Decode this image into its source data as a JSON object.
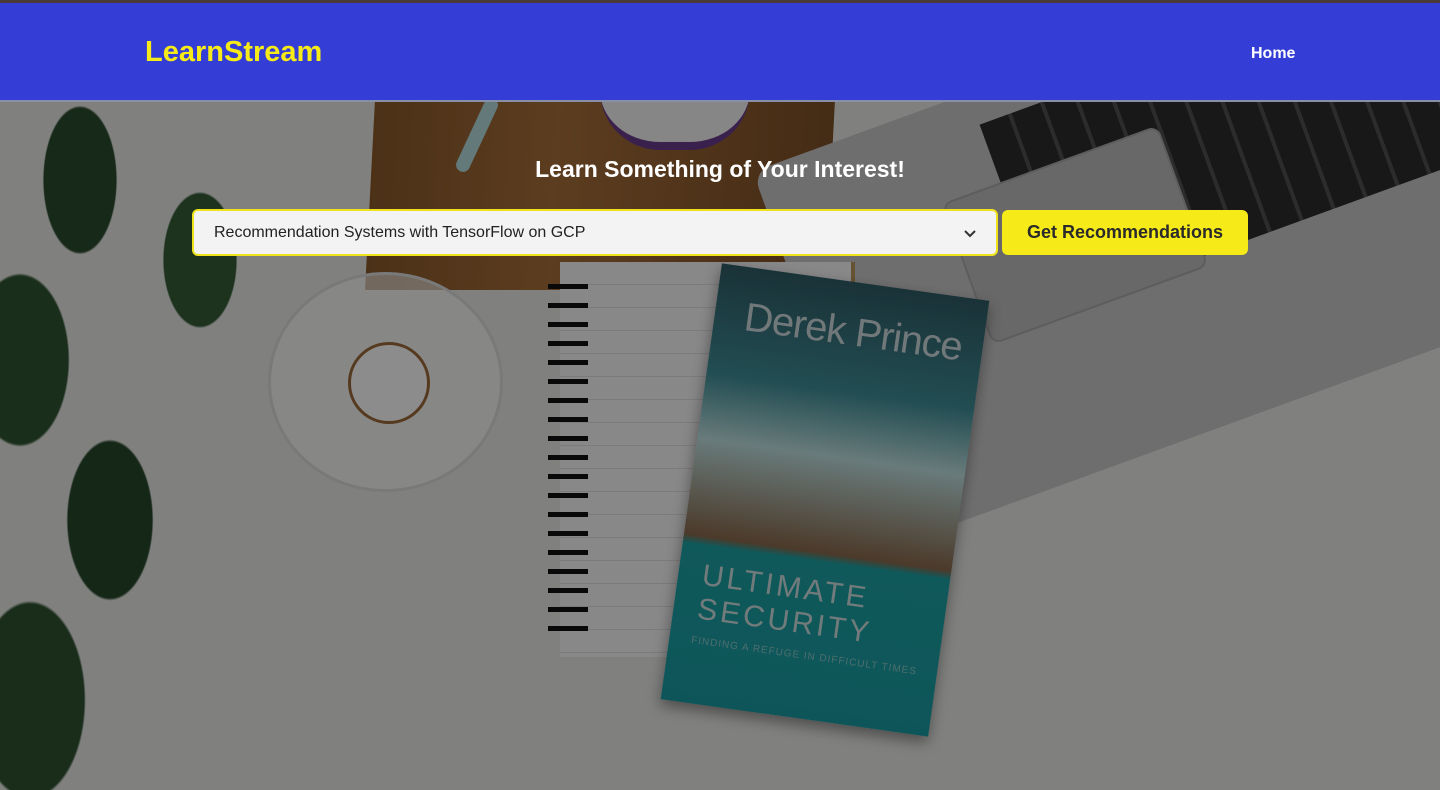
{
  "header": {
    "brand": "LearnStream",
    "nav": {
      "home_label": "Home"
    }
  },
  "hero": {
    "title": "Learn Something of Your Interest!",
    "select": {
      "selected_value": "Recommendation Systems with TensorFlow on GCP"
    },
    "button_label": "Get Recommendations"
  },
  "background": {
    "book": {
      "author": "Derek Prince",
      "title": "Ultimate\nSecurity",
      "subtitle": "Finding a refuge in difficult times"
    }
  },
  "colors": {
    "header_bg": "#343ed6",
    "accent": "#f6ea18"
  },
  "icons": {
    "select_arrow": "chevron-down-icon"
  }
}
